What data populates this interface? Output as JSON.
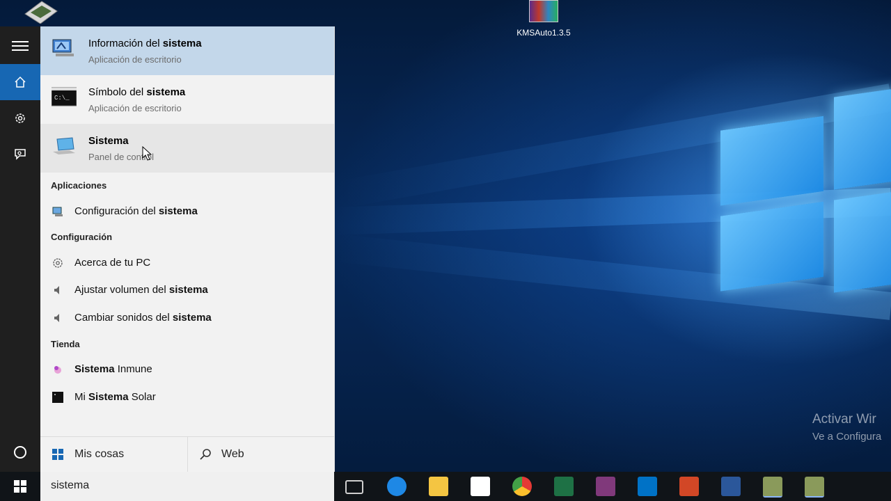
{
  "desktop": {
    "icon_label": "KMSAuto1.3.5",
    "watermark_line1": "Activar Wir",
    "watermark_line2": "Ve a Configura"
  },
  "results": [
    {
      "title_pre": "Información del ",
      "title_bold": "sistema",
      "subtitle": "Aplicación de escritorio"
    },
    {
      "title_pre": "Símbolo del ",
      "title_bold": "sistema",
      "subtitle": "Aplicación de escritorio"
    },
    {
      "title_pre": "",
      "title_bold": "Sistema",
      "subtitle": "Panel de control"
    }
  ],
  "sections": {
    "apps": "Aplicaciones",
    "config": "Configuración",
    "store": "Tienda"
  },
  "apps_items": [
    {
      "pre": "Configuración del ",
      "bold": "sistema",
      "post": ""
    }
  ],
  "config_items": [
    {
      "pre": "Acerca de tu PC",
      "bold": "",
      "post": ""
    },
    {
      "pre": "Ajustar volumen del ",
      "bold": "sistema",
      "post": ""
    },
    {
      "pre": "Cambiar sonidos del ",
      "bold": "sistema",
      "post": ""
    }
  ],
  "store_items": [
    {
      "pre": "",
      "bold": "Sistema",
      "post": " Inmune"
    },
    {
      "pre": "Mi ",
      "bold": "Sistema",
      "post": " Solar"
    }
  ],
  "tabs": {
    "my_stuff": "Mis cosas",
    "web": "Web"
  },
  "search": {
    "query": "sistema"
  },
  "taskbar_icons": [
    {
      "name": "task-view-icon",
      "color": "#cfcfcf"
    },
    {
      "name": "edge-icon",
      "color": "#1e88e5"
    },
    {
      "name": "file-explorer-icon",
      "color": "#f4c542"
    },
    {
      "name": "store-icon",
      "color": "#ffffff"
    },
    {
      "name": "chrome-icon",
      "color": "#e53935"
    },
    {
      "name": "excel-icon",
      "color": "#1e7145"
    },
    {
      "name": "onenote-icon",
      "color": "#80397b"
    },
    {
      "name": "outlook-icon",
      "color": "#0072c6"
    },
    {
      "name": "powerpoint-icon",
      "color": "#d24726"
    },
    {
      "name": "word-icon",
      "color": "#2b579a"
    },
    {
      "name": "app-icon-1",
      "color": "#8a9a5b"
    },
    {
      "name": "app-icon-2",
      "color": "#8a9a5b"
    }
  ]
}
